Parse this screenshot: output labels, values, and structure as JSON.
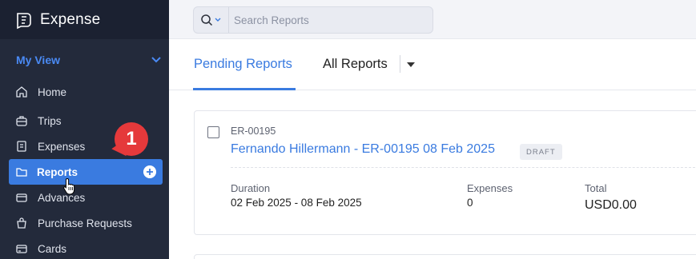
{
  "app": {
    "name": "Expense"
  },
  "sidebar": {
    "section_label": "My View",
    "items": [
      {
        "label": "Home",
        "icon": "home-icon"
      },
      {
        "label": "Trips",
        "icon": "suitcase-icon"
      },
      {
        "label": "Expenses",
        "icon": "receipt-icon"
      },
      {
        "label": "Reports",
        "icon": "folder-icon",
        "active": true
      },
      {
        "label": "Advances",
        "icon": "advance-icon"
      },
      {
        "label": "Purchase Requests",
        "icon": "bag-icon"
      },
      {
        "label": "Cards",
        "icon": "card-icon"
      }
    ]
  },
  "annotation": {
    "step": "1"
  },
  "search": {
    "placeholder": "Search Reports",
    "value": ""
  },
  "tabs": [
    {
      "label": "Pending Reports",
      "active": true
    },
    {
      "label": "All Reports",
      "active": false
    }
  ],
  "report": {
    "id": "ER-00195",
    "title": "Fernando Hillermann - ER-00195 08 Feb 2025",
    "status": "DRAFT",
    "duration_label": "Duration",
    "duration_value": "02 Feb 2025 - 08 Feb 2025",
    "expenses_label": "Expenses",
    "expenses_value": "0",
    "total_label": "Total",
    "total_value": "USD0.00"
  },
  "colors": {
    "accent": "#3a7be0",
    "sidebar_bg": "#232a3b",
    "badge": "#e5393b"
  }
}
